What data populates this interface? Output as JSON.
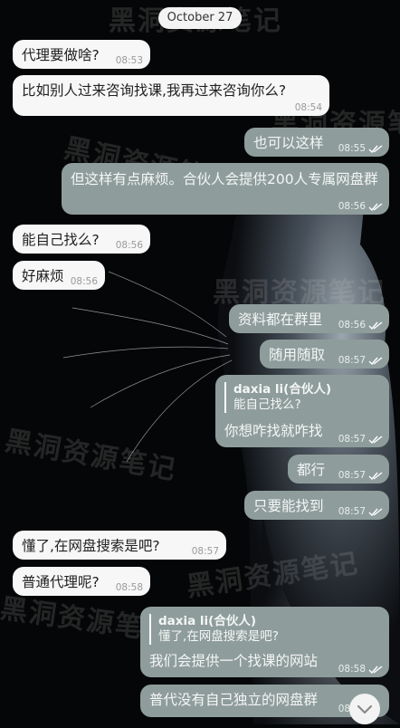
{
  "date_header": "October 27",
  "watermark_text": "黑洞资源笔记",
  "colors": {
    "incoming_bubble": "#f7f7f7",
    "outgoing_bubble": "#8e9d9b",
    "background": "#050607"
  },
  "messages": [
    {
      "dir": "in",
      "text": "代理要做啥?",
      "time": "08:53"
    },
    {
      "dir": "in",
      "text": "比如别人过来咨询找课,我再过来咨询你么?",
      "time": "08:54"
    },
    {
      "dir": "out",
      "text": "也可以这样",
      "time": "08:55"
    },
    {
      "dir": "out",
      "text": "但这样有点麻烦。合伙人会提供200人专属网盘群",
      "time": "08:56"
    },
    {
      "dir": "in",
      "text": "能自己找么?",
      "time": "08:56"
    },
    {
      "dir": "in",
      "text": "好麻烦",
      "time": "08:56"
    },
    {
      "dir": "out",
      "text": "资料都在群里",
      "time": "08:56"
    },
    {
      "dir": "out",
      "text": "随用随取",
      "time": "08:57"
    },
    {
      "dir": "out",
      "reply_name": "daxia li(合伙人)",
      "reply_text": "能自己找么?",
      "text": "你想咋找就咋找",
      "time": "08:57"
    },
    {
      "dir": "out",
      "text": "都行",
      "time": "08:57"
    },
    {
      "dir": "out",
      "text": "只要能找到",
      "time": "08:57"
    },
    {
      "dir": "in",
      "text": "懂了,在网盘搜索是吧?",
      "time": "08:57"
    },
    {
      "dir": "in",
      "text": "普通代理呢?",
      "time": "08:58"
    },
    {
      "dir": "out",
      "reply_name": "daxia li(合伙人)",
      "reply_text": "懂了,在网盘搜索是吧?",
      "text": "我们会提供一个找课的网站",
      "time": "08:58"
    },
    {
      "dir": "out",
      "text": "普代没有自己独立的网盘群",
      "time": "08:58"
    }
  ],
  "icons": {
    "read_receipt": "double-check-icon",
    "scroll_down": "chevron-down-icon"
  }
}
